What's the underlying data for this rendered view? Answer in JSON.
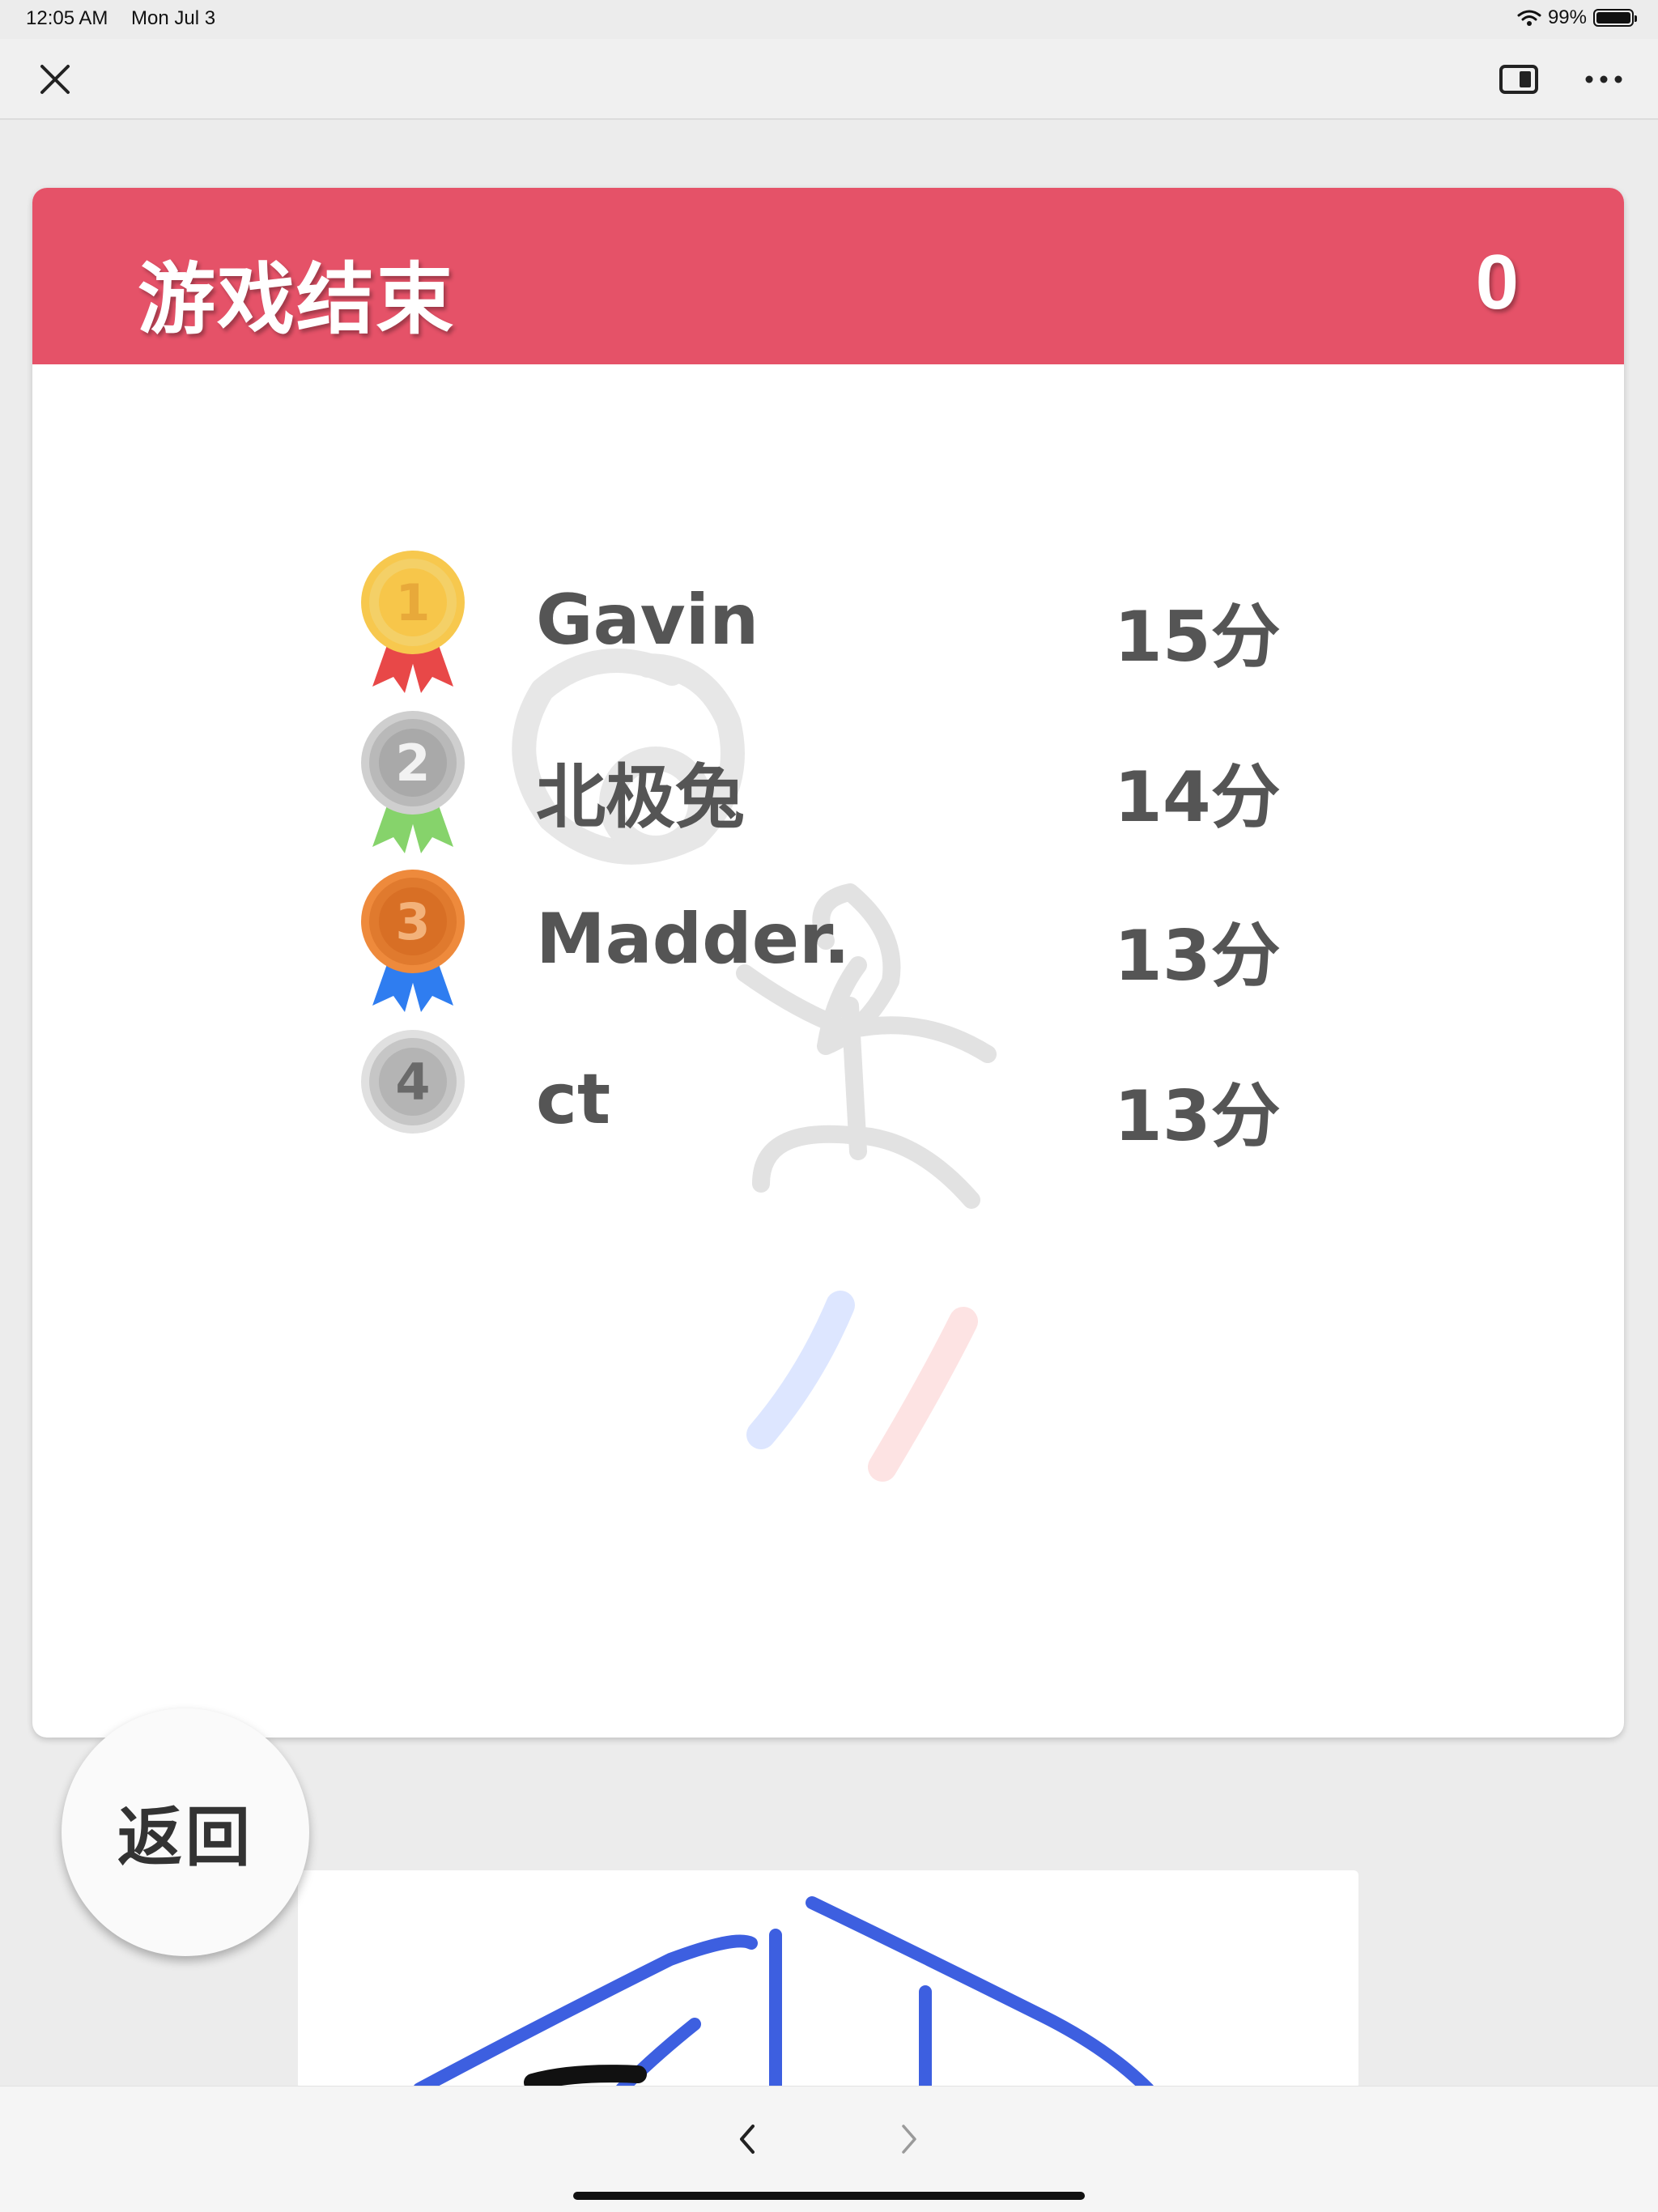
{
  "status_bar": {
    "time": "12:05 AM",
    "date": "Mon Jul 3",
    "battery": "99%"
  },
  "nav": {
    "close_icon": "close-icon",
    "split_icon": "split-view-icon",
    "more_icon": "more-icon"
  },
  "card": {
    "title": "游戏结束",
    "score": "0",
    "header_color": "#e55268"
  },
  "rankings": [
    {
      "rank": "1",
      "name": "Gavin",
      "score": "15分",
      "medal": "gold-medal-icon"
    },
    {
      "rank": "2",
      "name": "北极兔",
      "score": "14分",
      "medal": "silver-medal-icon"
    },
    {
      "rank": "3",
      "name": "Madder.",
      "score": "13分",
      "medal": "bronze-medal-icon"
    },
    {
      "rank": "4",
      "name": "ct",
      "score": "13分",
      "medal": "rank-badge-icon"
    }
  ],
  "back_button": {
    "label": "返回"
  },
  "bottom_bar": {
    "back_icon": "chevron-left-icon",
    "forward_icon": "chevron-right-icon"
  }
}
